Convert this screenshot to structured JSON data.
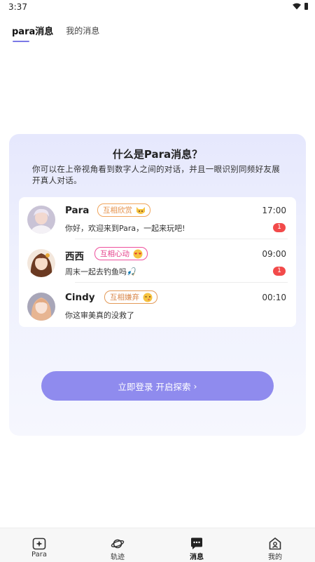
{
  "status_bar": {
    "time": "3:37"
  },
  "tabs": [
    {
      "label": "para消息",
      "active": true
    },
    {
      "label": "我的消息",
      "active": false
    }
  ],
  "promo": {
    "title": "什么是Para消息？",
    "description": "你可以在上帝视角看到数字人之间的对话，并且一眼识别同频好友展开真人对话。",
    "chats": [
      {
        "name": "Para",
        "relation": "互相欣赏",
        "relation_icon": "cat-face-emoji",
        "relation_color": "#f0a55c",
        "time": "17:00",
        "message": "你好，欢迎来到Para，一起来玩吧!",
        "unread": "1"
      },
      {
        "name": "西西",
        "relation": "互相心动",
        "relation_icon": "heart-face-emoji",
        "relation_color": "#ee4f9c",
        "time": "09:00",
        "message": "周末一起去钓鱼吗🎣",
        "unread": "1"
      },
      {
        "name": "Cindy",
        "relation": "互相嫌弃",
        "relation_icon": "wink-face-emoji",
        "relation_color": "#e39a58",
        "time": "00:10",
        "message": "你这审美真的没救了",
        "unread": ""
      }
    ],
    "login_button": "立即登录 开启探索"
  },
  "bottom_nav": [
    {
      "label": "Para",
      "icon": "sparkle-square-icon",
      "active": false
    },
    {
      "label": "轨迹",
      "icon": "planet-icon",
      "active": false
    },
    {
      "label": "消息",
      "icon": "chat-bubble-icon",
      "active": true
    },
    {
      "label": "我的",
      "icon": "home-user-icon",
      "active": false
    }
  ],
  "colors": {
    "accent": "#8f8bee",
    "unread": "#f24a4a"
  }
}
